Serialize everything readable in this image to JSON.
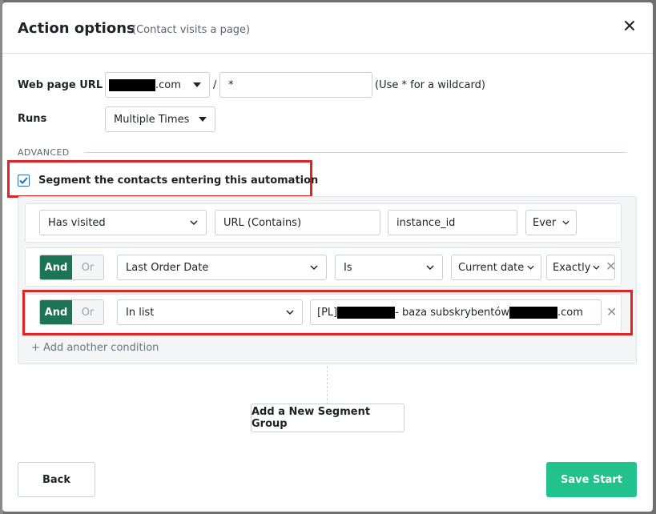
{
  "modal": {
    "title": "Action options",
    "subtitle": "(Contact visits a page)"
  },
  "form": {
    "web_page_url_label": "Web page URL",
    "domain_suffix": ".com",
    "slash": "/",
    "path_value": "*",
    "wildcard_hint": "(Use * for a wildcard)",
    "runs_label": "Runs",
    "runs_value": "Multiple Times"
  },
  "advanced": {
    "label": "ADVANCED",
    "segment_checkbox_label": "Segment the contacts entering this automation",
    "segment_checked": true
  },
  "conditions": [
    {
      "field": "Has visited",
      "operator": "URL (Contains)",
      "value": "instance_id",
      "time": "Ever"
    },
    {
      "and": "And",
      "or": "Or",
      "field": "Last Order Date",
      "operator": "Is",
      "value": "Current date",
      "modifier": "Exactly"
    },
    {
      "and": "And",
      "or": "Or",
      "field": "In list",
      "value_prefix": "[PL]",
      "value_middle": " - baza subskrybentów",
      "value_suffix": ".com"
    }
  ],
  "add_condition_label": "+ Add another condition",
  "add_segment_group_label": "Add a New Segment Group",
  "footer": {
    "back_label": "Back",
    "save_label": "Save Start"
  },
  "colors": {
    "accent_green": "#22c28c",
    "and_active": "#1c7455",
    "highlight_red": "#e02424"
  }
}
